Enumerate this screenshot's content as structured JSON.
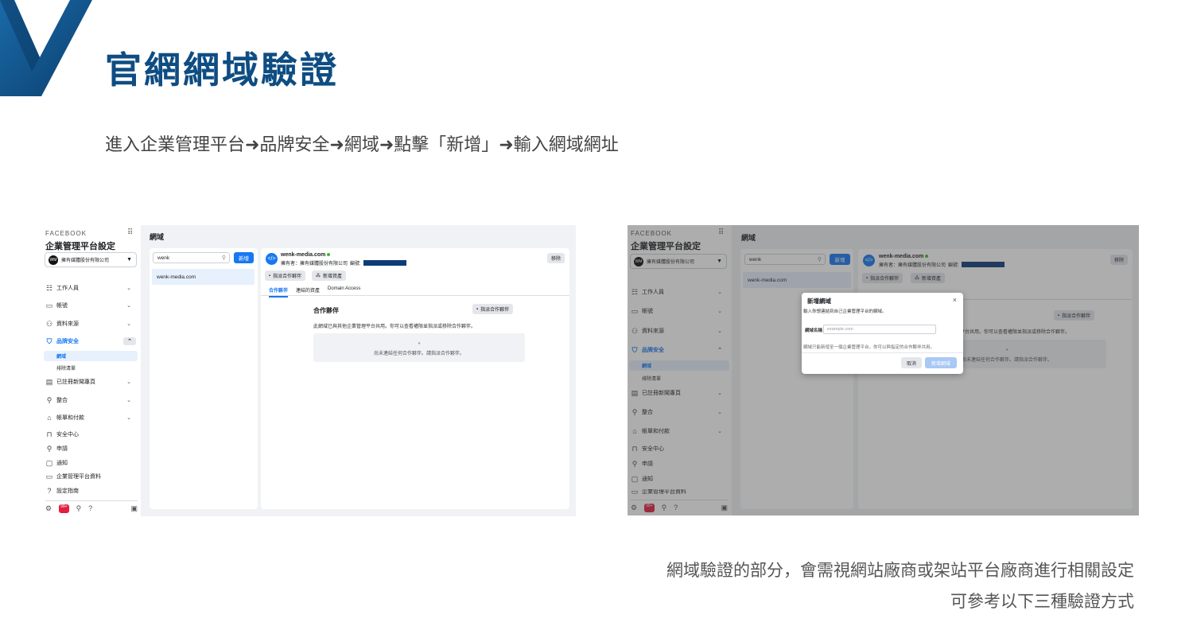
{
  "slide": {
    "title": "官網網域驗證",
    "subtitle": "進入企業管理平台➜品牌安全➜網域➜點擊「新增」➜輸入網域網址",
    "footnote_line1": "網域驗證的部分，會需視網站廠商或架站平台廠商進行相關設定",
    "footnote_line2": "可參考以下三種驗證方式",
    "colors": {
      "title": "#0e4d82",
      "accent_shape": "#0e4d82",
      "fb_blue": "#1877f2"
    }
  },
  "sidebar": {
    "brand_small": "FACEBOOK",
    "brand_title": "企業管理平台設定",
    "account_logo": "WM",
    "account_name": "擁有媒體股份有限公司",
    "nav": [
      {
        "label": "工作人員",
        "icon": "people-icon"
      },
      {
        "label": "帳號",
        "icon": "store-icon"
      },
      {
        "label": "資料來源",
        "icon": "users-icon"
      },
      {
        "label": "品牌安全",
        "icon": "shield-icon"
      },
      {
        "label": "已註冊新聞專頁",
        "icon": "clipboard-icon"
      },
      {
        "label": "整合",
        "icon": "nodes-icon"
      },
      {
        "label": "帳單和付款",
        "icon": "bank-icon"
      },
      {
        "label": "安全中心",
        "icon": "lock-icon"
      },
      {
        "label": "申請",
        "icon": "user-add-icon"
      },
      {
        "label": "通知",
        "icon": "bell-icon"
      },
      {
        "label": "企業管理平台資料",
        "icon": "briefcase-icon"
      },
      {
        "label": "設定指南",
        "icon": "help-icon"
      }
    ],
    "sub_items": [
      "網域",
      "排除清單"
    ],
    "badge": "99+"
  },
  "page": {
    "heading": "網域",
    "search_value": "wenk",
    "add_button": "新增",
    "domain_list_item": "wenk-media.com",
    "domain_icon": "</>",
    "domain_name": "wenk-media.com",
    "owner_label": "擁有者：擁有媒體股份有限公司",
    "owner_id_label": "編號:",
    "remove_button": "移除",
    "assign_partner_button": "指派合作夥伴",
    "add_asset_button": "新增資產",
    "tabs": [
      "合作夥伴",
      "連結的資產",
      "Domain Access"
    ],
    "partners_title": "合作夥伴",
    "partners_assign_button": "指派合作夥伴",
    "partners_desc": "此網域已與其他企業管理平台共用。你可以查看權限並指派或移除合作夥伴。",
    "empty_text": "尚未連結任何合作夥伴。請指派合作夥伴。"
  },
  "modal": {
    "title": "新增網域",
    "intro": "輸入你想連結到自己企業管理平台的網域。",
    "field_label": "網域名稱",
    "placeholder": "example.com",
    "note": "網域只能新增至一個企業管理平台，你可以與指定的合作夥伴共用。",
    "cancel_button": "取消",
    "submit_button": "新增網域"
  }
}
